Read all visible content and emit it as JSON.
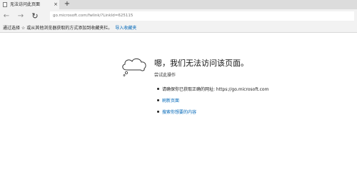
{
  "tab": {
    "title": "无法访问此页面",
    "close_glyph": "×"
  },
  "new_tab_glyph": "+",
  "nav": {
    "back_glyph": "←",
    "forward_glyph": "→",
    "refresh_glyph": "↻",
    "address": "go.microsoft.com/fwlink/?LinkId=625115"
  },
  "favorites_bar": {
    "hint": "通过选择 ☆ 或从其他浏览器获取的方式添加到收藏夹栏。",
    "import_link": "导入收藏夹"
  },
  "error_page": {
    "heading": "嗯，我们无法访问该页面。",
    "subheading": "尝试此操作",
    "suggestions": [
      {
        "text": "请确保你已获取正确的网址: https://go.microsoft.com"
      },
      {
        "text": "刷新页面"
      },
      {
        "text": "搜索你想要的内容"
      }
    ]
  },
  "colors": {
    "link": "#0067b8",
    "chrome_bg": "#f2f2f2",
    "tabstrip_bg": "#dcdcdc"
  }
}
